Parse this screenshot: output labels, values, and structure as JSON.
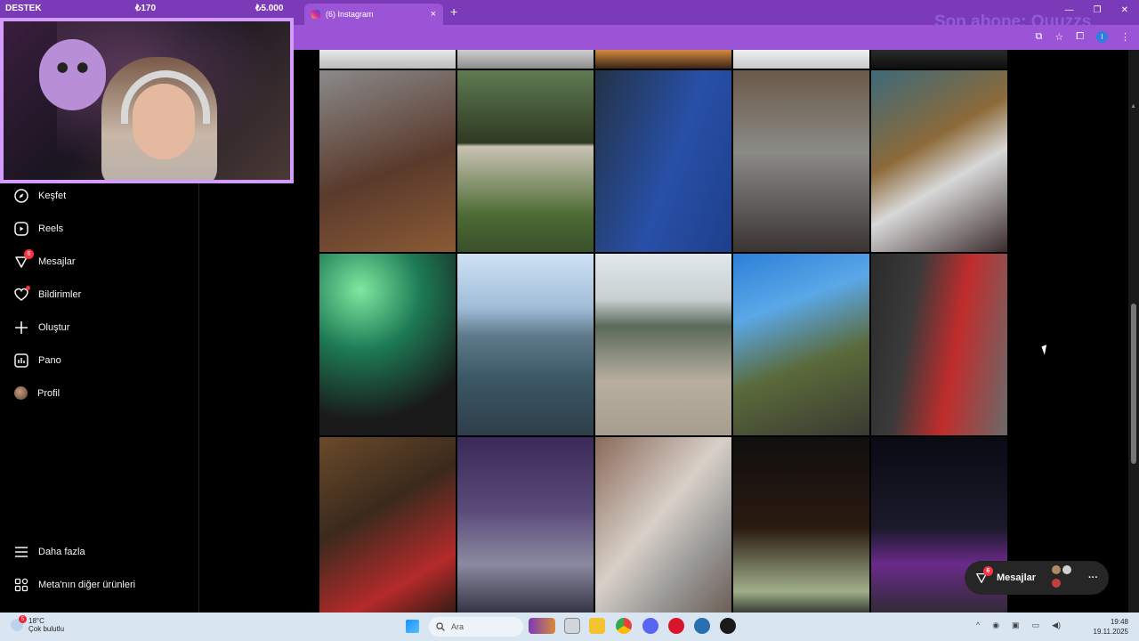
{
  "stream_overlay": {
    "bar_label": "DESTEK",
    "amount_1": "₺170",
    "amount_2": "₺5.000",
    "subscriber_text": "Son abone: Quuzzs"
  },
  "browser": {
    "tab_title": "(6) Instagram",
    "tab_close": "×",
    "new_tab": "+",
    "window_controls": [
      "—",
      "❐",
      "✕"
    ]
  },
  "sidebar": {
    "items": [
      {
        "label": "Keşfet",
        "icon": "compass-icon"
      },
      {
        "label": "Reels",
        "icon": "reels-icon"
      },
      {
        "label": "Mesajlar",
        "icon": "messenger-icon",
        "badge": "6"
      },
      {
        "label": "Bildirimler",
        "icon": "heart-icon"
      },
      {
        "label": "Oluştur",
        "icon": "plus-icon"
      },
      {
        "label": "Pano",
        "icon": "dashboard-icon"
      },
      {
        "label": "Profil",
        "icon": "profile-avatar"
      }
    ],
    "more_label": "Daha fazla",
    "meta_label": "Meta'nın diğer ürünleri"
  },
  "messages_pill": {
    "label": "Mesajlar",
    "badge": "6",
    "more": "···"
  },
  "taskbar": {
    "weather_temp": "18°C",
    "weather_desc": "Çok bulutlu",
    "weather_badge": "5",
    "search_placeholder": "Ara",
    "time": "19:48",
    "date": "19.11.2025"
  },
  "colors": {
    "accent_purple": "#7b3bb8",
    "notification_red": "#ff3040"
  }
}
